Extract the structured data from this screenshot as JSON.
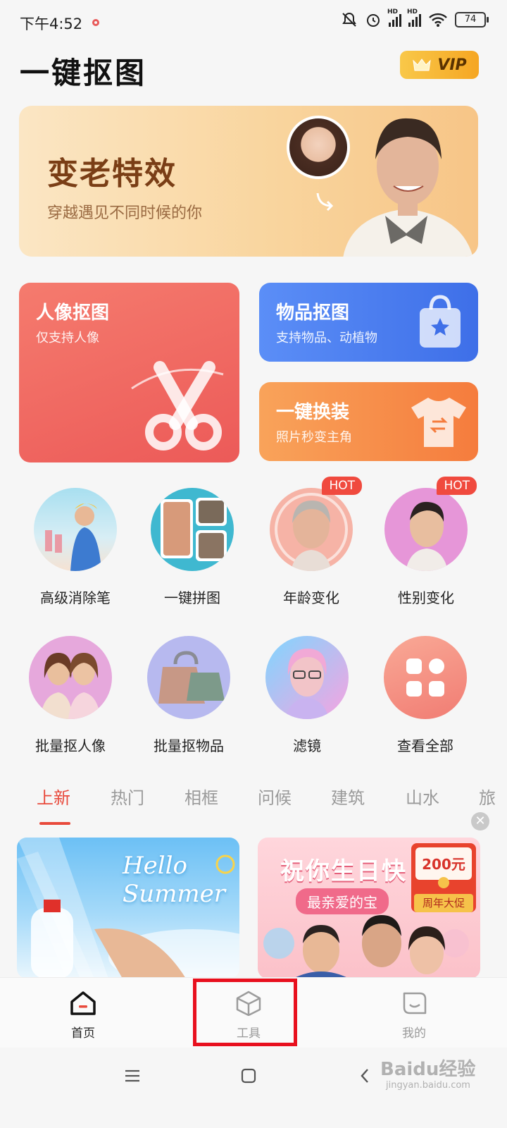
{
  "status_bar": {
    "time": "下午4:52",
    "battery": "74",
    "hd1": "HD",
    "hd2": "HD"
  },
  "header": {
    "title": "一键抠图",
    "vip_label": "VIP"
  },
  "banner": {
    "title": "变老特效",
    "subtitle": "穿越遇见不同时候的你"
  },
  "feature_cards": {
    "portrait": {
      "title": "人像抠图",
      "subtitle": "仅支持人像"
    },
    "object": {
      "title": "物品抠图",
      "subtitle": "支持物品、动植物"
    },
    "outfit": {
      "title": "一键换装",
      "subtitle": "照片秒变主角"
    }
  },
  "tools": [
    {
      "label": "高级消除笔"
    },
    {
      "label": "一键拼图"
    },
    {
      "label": "年龄变化",
      "badge": "HOT"
    },
    {
      "label": "性别变化",
      "badge": "HOT"
    },
    {
      "label": "批量抠人像"
    },
    {
      "label": "批量抠物品"
    },
    {
      "label": "滤镜"
    },
    {
      "label": "查看全部"
    }
  ],
  "category_tabs": [
    "上新",
    "热门",
    "相框",
    "问候",
    "建筑",
    "山水",
    "旅"
  ],
  "thumbnails": {
    "summer": {
      "text_line1": "Hello",
      "text_line2": "Summer"
    },
    "birthday": {
      "title": "祝你生日快",
      "subtitle": "最亲爱的宝"
    }
  },
  "promo": {
    "amount": "200元",
    "tag": "周年大促"
  },
  "bottom_nav": [
    {
      "label": "首页",
      "active": true
    },
    {
      "label": "工具",
      "active": false
    },
    {
      "label": "我的",
      "active": false
    }
  ],
  "watermark": {
    "text": "Baidu经验",
    "sub": "jingyan.baidu.com"
  },
  "colors": {
    "accent": "#e84a3c",
    "highlight_box": "#e8101e",
    "vip_gold": "#f5a623"
  }
}
